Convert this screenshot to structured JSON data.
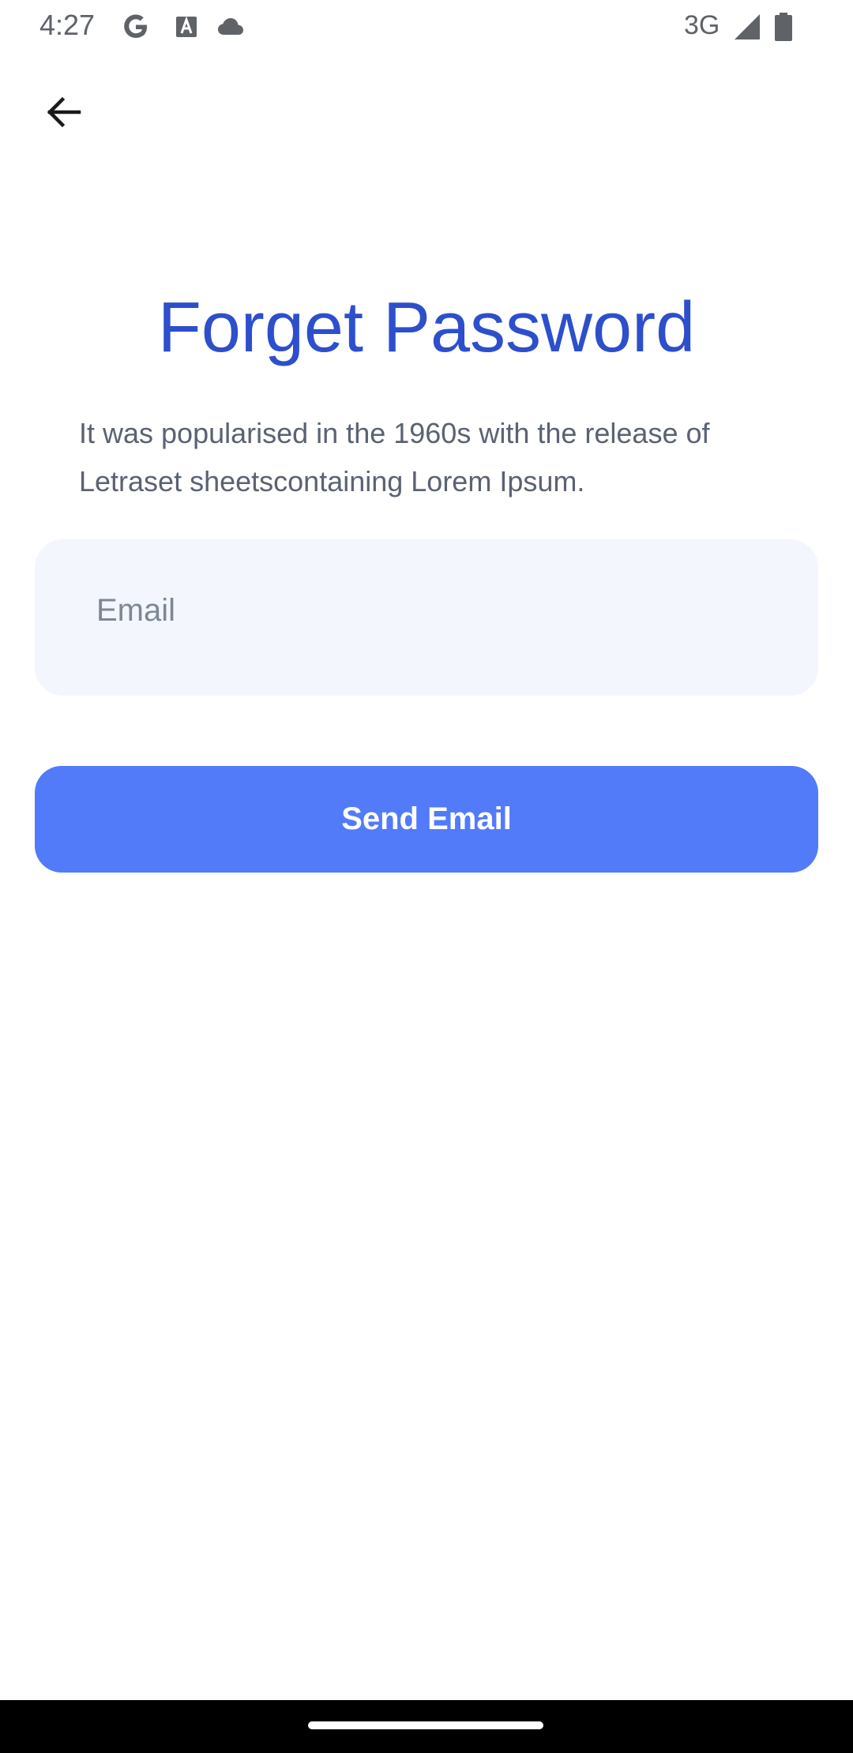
{
  "status_bar": {
    "time": "4:27",
    "network": "3G",
    "icons": [
      "google-icon",
      "text-a-icon",
      "cloud-icon",
      "signal-icon",
      "battery-icon"
    ]
  },
  "header": {
    "back_icon": "arrow-left-icon"
  },
  "main": {
    "title": "Forget Password",
    "description": "It was popularised in the 1960s with the release of Letraset sheetscontaining Lorem Ipsum.",
    "email_field": {
      "placeholder": "Email",
      "value": ""
    },
    "send_button_label": "Send Email"
  },
  "colors": {
    "accent": "#527bfa",
    "title": "#2d4fcc",
    "field_bg": "#f3f6fc"
  }
}
